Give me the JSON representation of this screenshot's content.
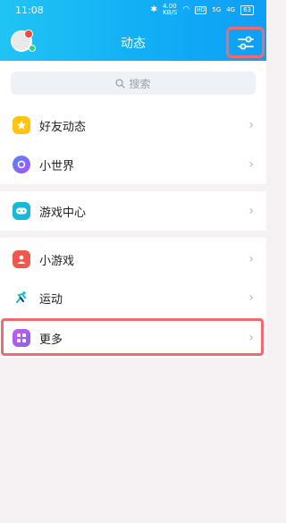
{
  "status_bar": {
    "time": "11:08",
    "network_speed": "4.00",
    "speed_unit": "KB/S",
    "hd_badge": "HD",
    "signal_5g": "5G",
    "signal_4g": "4G",
    "battery": "63"
  },
  "header": {
    "title": "动态"
  },
  "search": {
    "placeholder": "搜索"
  },
  "menu": [
    {
      "label": "好友动态",
      "icon": "star-icon",
      "color": "#ffc412"
    },
    {
      "label": "小世界",
      "icon": "planet-icon",
      "color": "#8b5cf6"
    },
    {
      "label": "游戏中心",
      "icon": "gamepad-icon",
      "color": "#16b9d6"
    },
    {
      "label": "小游戏",
      "icon": "person-icon",
      "color": "#f0574d"
    },
    {
      "label": "运动",
      "icon": "run-icon",
      "color": "#15b9d6"
    },
    {
      "label": "更多",
      "icon": "grid-icon",
      "color": "#a45ff2"
    }
  ],
  "colors": {
    "header_gradient_start": "#20c4f4",
    "header_gradient_end": "#0e9ff5",
    "highlight": "#f06a6f"
  }
}
